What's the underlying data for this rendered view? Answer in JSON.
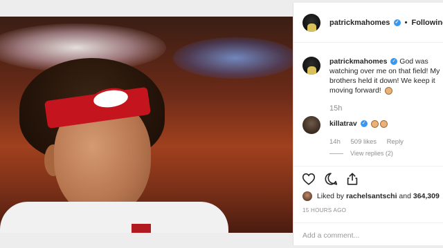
{
  "header": {
    "username": "patrickmahomes",
    "verified_mark": "✓",
    "separator": "•",
    "follow_label": "Following"
  },
  "caption": {
    "username": "patrickmahomes",
    "text": "God was watching over me on that field! My brothers held it down! We keep it moving forward!",
    "emoji": "flexed-biceps",
    "time": "15h"
  },
  "comment": {
    "username": "killatrav",
    "emoji": "flexed-biceps ×2",
    "time": "14h",
    "likes": "509 likes",
    "reply_label": "Reply",
    "view_replies": "View replies (2)"
  },
  "actions": {
    "icons": [
      "heart-icon",
      "comment-icon",
      "share-icon"
    ]
  },
  "likes": {
    "prefix": "Liked by",
    "user": "rachelsantschi",
    "conj": "and",
    "count": "364,309"
  },
  "post_age": "15 HOURS AGO",
  "add_comment": {
    "placeholder": "Add a comment..."
  }
}
